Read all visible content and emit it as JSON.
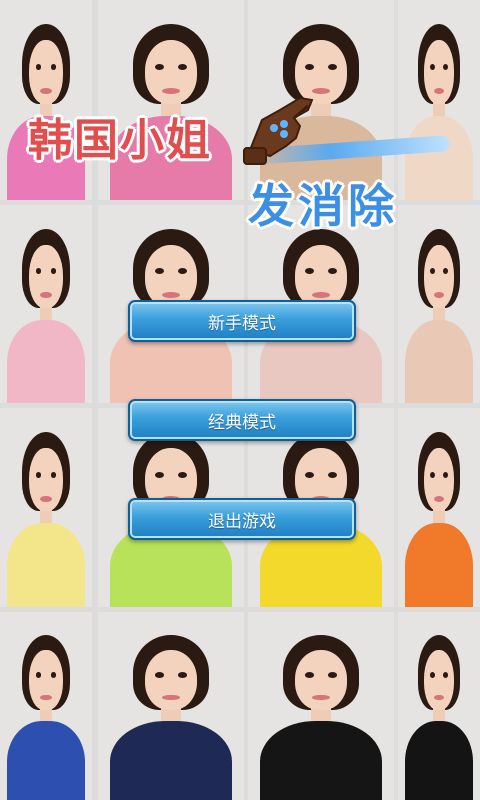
{
  "title": {
    "line1": "韩国小姐",
    "line2": "发消除",
    "line1_color": "#e24d4d",
    "line2_color": "#3c8fe4"
  },
  "menu": {
    "new_mode": "新手模式",
    "classic_mode": "经典模式",
    "exit_game": "退出游戏"
  },
  "background": {
    "tiles": [
      {
        "dress": "#e97ab7"
      },
      {
        "dress": "#e67aa8"
      },
      {
        "dress": "#d9b89b"
      },
      {
        "dress": "#efd8c6"
      },
      {
        "dress": "#f2b7c6"
      },
      {
        "dress": "#f0c2b4"
      },
      {
        "dress": "#e8c8c0"
      },
      {
        "dress": "#e9c9b6"
      },
      {
        "dress": "#f2e58a"
      },
      {
        "dress": "#b8e25a"
      },
      {
        "dress": "#f3d92c"
      },
      {
        "dress": "#f07a2a"
      },
      {
        "dress": "#2d4fb0"
      },
      {
        "dress": "#1e2a55"
      },
      {
        "dress": "#151515"
      },
      {
        "dress": "#141414"
      }
    ]
  },
  "icons": {
    "pointer": "pointing-hand-icon"
  }
}
